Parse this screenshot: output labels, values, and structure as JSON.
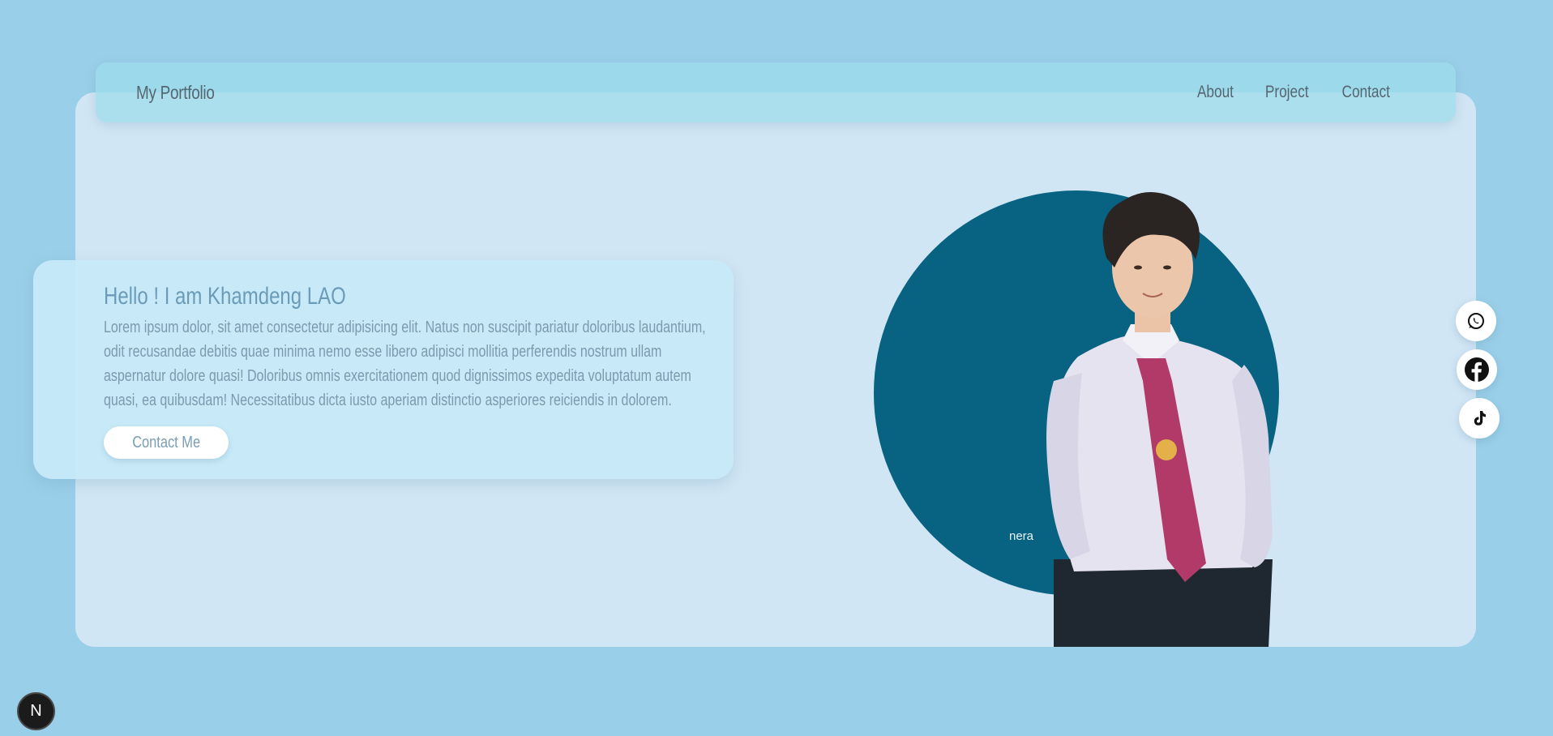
{
  "nav": {
    "brand": "My Portfolio",
    "links": [
      {
        "label": "About"
      },
      {
        "label": "Project"
      },
      {
        "label": "Contact"
      }
    ]
  },
  "hero": {
    "title": "Hello ! I am Khamdeng LAO",
    "description": "Lorem ipsum dolor, sit amet consectetur adipisicing elit. Natus non suscipit pariatur doloribus laudantium, odit recusandae debitis quae minima nemo esse libero adipisci mollitia perferendis nostrum ullam aspernatur dolore quasi! Doloribus omnis exercitationem quod dignissimos expedita voluptatum autem quasi, ea quibusdam! Necessitatibus dicta iusto aperiam distinctio asperiores reiciendis in dolorem.",
    "cta_label": "Contact Me"
  },
  "photo": {
    "caption": "nera"
  },
  "social": [
    {
      "icon": "whatsapp-icon"
    },
    {
      "icon": "facebook-icon"
    },
    {
      "icon": "tiktok-icon"
    }
  ],
  "dev_badge": {
    "label": "N",
    "icon": "nextjs-icon"
  },
  "colors": {
    "page_bg": "#9acfe9",
    "card_bg": "#d1e6f5",
    "circle": "#086282",
    "tie": "#b23a68"
  }
}
